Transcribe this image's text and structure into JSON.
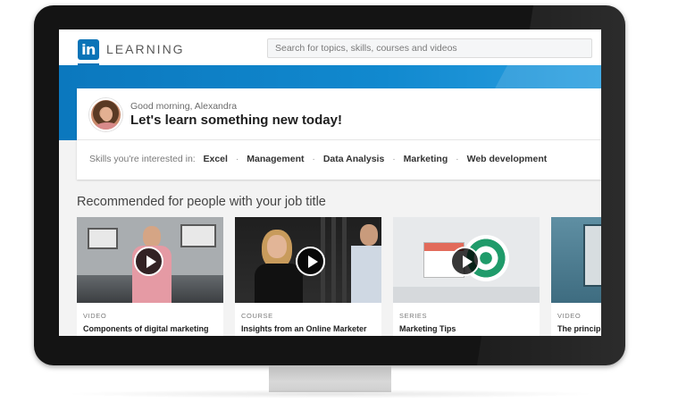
{
  "app": {
    "logo_mark": "in",
    "logo_text": "LEARNING"
  },
  "search": {
    "placeholder": "Search for topics, skills, courses and videos"
  },
  "greeting": {
    "small": "Good morning, Alexandra",
    "big": "Let's learn something new today!"
  },
  "skills": {
    "label": "Skills you're interested in:",
    "items": [
      "Excel",
      "Management",
      "Data Analysis",
      "Marketing",
      "Web development"
    ]
  },
  "section": {
    "title": "Recommended for people with your job title"
  },
  "courses": [
    {
      "type": "VIDEO",
      "title": "Components of digital marketing"
    },
    {
      "type": "COURSE",
      "title": "Insights from an Online Marketer"
    },
    {
      "type": "SERIES",
      "title": "Marketing Tips"
    },
    {
      "type": "VIDEO",
      "title": "The principl"
    }
  ],
  "colors": {
    "brand": "#0a73b7",
    "band": "#1189cf"
  }
}
